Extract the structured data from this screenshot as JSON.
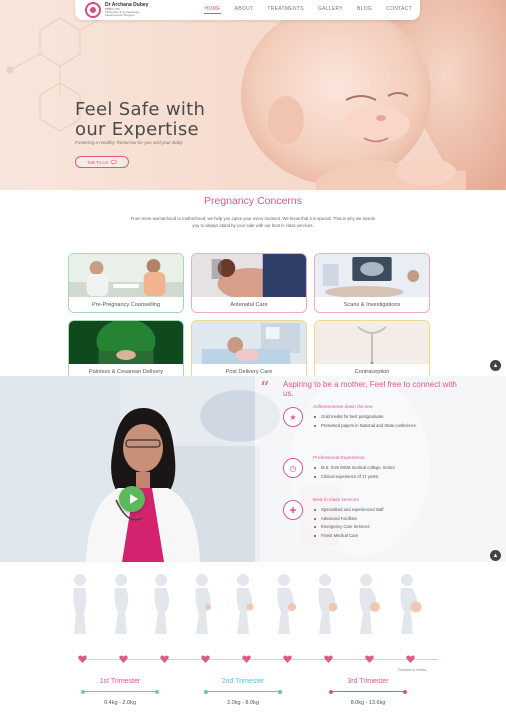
{
  "header": {
    "logo_name": "Dr Archana Dubey",
    "logo_sub1": "MBBS, MS",
    "logo_sub2": "Obstetrics & Gynaecology",
    "logo_sub3": "Laparoscopic Surgeon",
    "nav": [
      "HOME",
      "ABOUT",
      "TREATMENTS",
      "GALLERY",
      "BLOG",
      "CONTACT"
    ],
    "active_nav": "HOME"
  },
  "hero": {
    "title_line1": "Feel Safe with",
    "title_line2": "our Expertise",
    "subtitle": "Fostering a Healthy Tomorrow for you and your Baby",
    "button_label": "Talk To Us"
  },
  "concerns": {
    "title": "Pregnancy Concerns",
    "description": "From mere womanhood to motherhood, we help you carve your every moment. We know that it is special. That is why we assure you to always stand by your side with our best in class services.",
    "cards": [
      {
        "label": "Pre-Pregnancy Counselling"
      },
      {
        "label": "Antenatal Care"
      },
      {
        "label": "Scans & Investigations"
      },
      {
        "label": "Painless & Cesarean Delivery"
      },
      {
        "label": "Post Delivery Care"
      },
      {
        "label": "Contraception"
      }
    ]
  },
  "experience": {
    "title": "Aspiring to be a mother, Feel free to connect with us.",
    "items": [
      {
        "heading": "Achievements down the line",
        "points": [
          "Gold medal for best postgraduate.",
          "Presented papers in National and State conference."
        ]
      },
      {
        "heading": "Professional Experience",
        "points": [
          "M.S. from MGM medical college, Indore",
          "Clinical experience of 17 years."
        ]
      },
      {
        "heading": "Best in class services",
        "points": [
          "Specialized and experienced staff",
          "Advanced Facilities",
          "Emergency Care Services",
          "Finest Medical Care"
        ]
      }
    ]
  },
  "stages": {
    "note": "Pumpkin in weeks",
    "trimesters": [
      {
        "label": "1st Trimester",
        "value": "0.4kg - 2.0kg"
      },
      {
        "label": "2nd Trimester",
        "value": "2.0kg - 8.0kg"
      },
      {
        "label": "3rd Trimester",
        "value": "8.0kg - 13.6kg"
      }
    ]
  },
  "colors": {
    "accent": "#e0588a",
    "teal": "#5bc6c9",
    "green": "#7cc9a0"
  }
}
